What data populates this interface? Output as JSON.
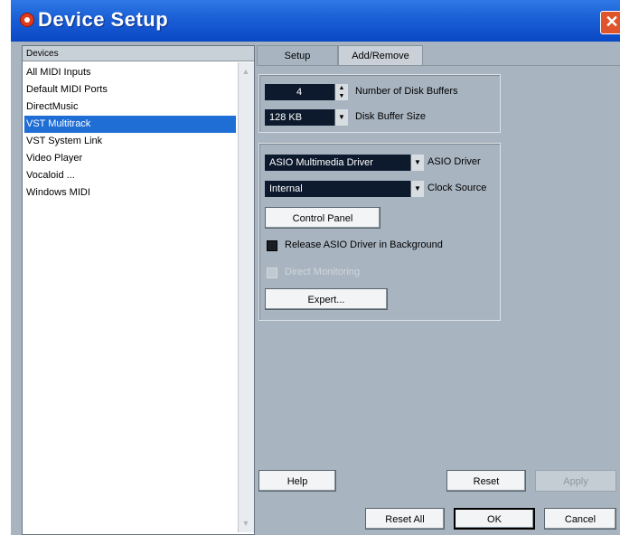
{
  "window": {
    "title": "Device Setup",
    "close_glyph": "✕"
  },
  "devices": {
    "header": "Devices",
    "items": [
      "All MIDI Inputs",
      "Default MIDI Ports",
      "DirectMusic",
      "VST Multitrack",
      "VST System Link",
      "Video Player",
      "Vocaloid ...",
      "Windows MIDI"
    ],
    "selected_index": 3
  },
  "tabs": [
    "Setup",
    "Add/Remove"
  ],
  "disk": {
    "buffers_value": "4",
    "buffers_label": "Number of Disk Buffers",
    "buffer_size_value": "128 KB",
    "buffer_size_label": "Disk Buffer Size"
  },
  "asio": {
    "driver_value": "ASIO Multimedia Driver",
    "driver_label": "ASIO Driver",
    "clock_value": "Internal",
    "clock_label": "Clock Source",
    "control_panel_label": "Control Panel",
    "release_label": "Release ASIO Driver in Background",
    "direct_monitoring_label": "Direct Monitoring",
    "expert_label": "Expert..."
  },
  "buttons": {
    "help": "Help",
    "reset": "Reset",
    "apply": "Apply",
    "reset_all": "Reset All",
    "ok": "OK",
    "cancel": "Cancel"
  },
  "colors": {
    "title_bar": "#1a5fd6",
    "selection": "#1f6ed6",
    "panel_bg": "#a8b4c0",
    "field_bg": "#0d1a2e"
  }
}
